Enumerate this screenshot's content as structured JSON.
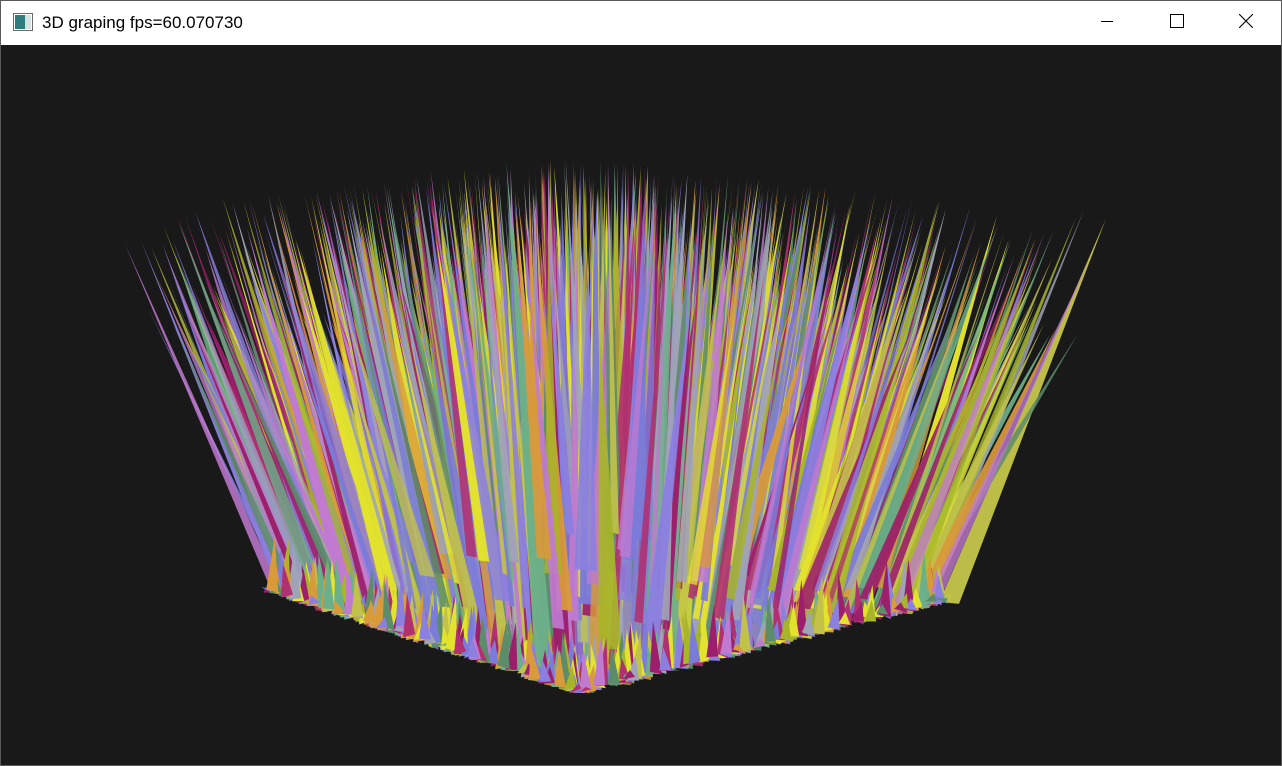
{
  "window": {
    "title": "3D graping fps=60.070730",
    "icon": "app-window-icon",
    "controls": {
      "minimize_icon": "minimize-icon",
      "maximize_icon": "maximize-icon",
      "close_icon": "close-icon"
    }
  },
  "scene": {
    "background": "#191919",
    "palette": [
      "#e3e32e",
      "#7b7bd9",
      "#9c1f6b",
      "#6bb08a",
      "#a7b52a",
      "#c07ad0",
      "#8b7fe0",
      "#d99a3a",
      "#5c8c6a",
      "#b03070",
      "#9fa3b8",
      "#c2c24a"
    ]
  }
}
